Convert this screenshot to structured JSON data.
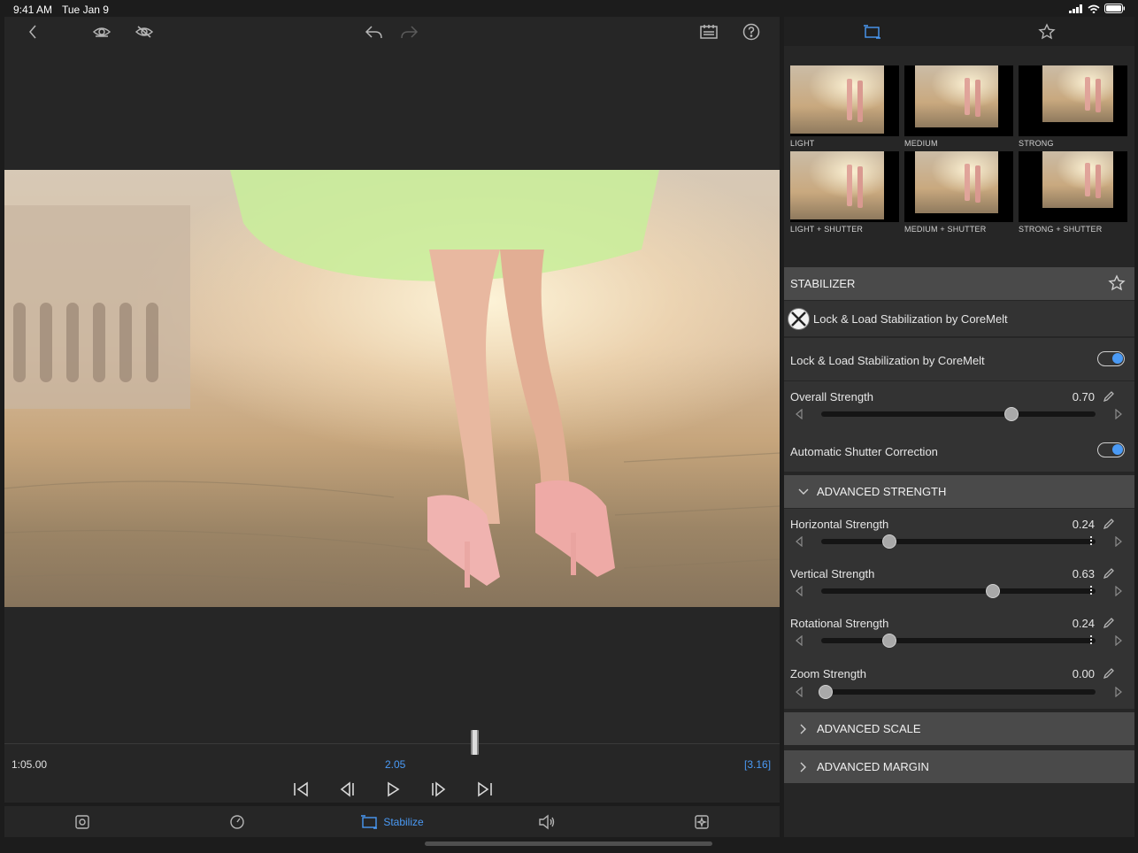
{
  "status_bar": {
    "time": "9:41 AM",
    "date": "Tue Jan 9"
  },
  "player": {
    "timecode_left": "1:05.00",
    "timecode_current": "2.05",
    "timecode_right": "[3.16]"
  },
  "bottom_tabs": {
    "stabilize_label": "Stabilize"
  },
  "presets": [
    {
      "label": "LIGHT"
    },
    {
      "label": "MEDIUM"
    },
    {
      "label": "STRONG"
    },
    {
      "label": "LIGHT + SHUTTER"
    },
    {
      "label": "MEDIUM + SHUTTER"
    },
    {
      "label": "STRONG + SHUTTER"
    }
  ],
  "stabilizer": {
    "header": "STABILIZER",
    "plugin_name": "Lock & Load Stabilization by CoreMelt",
    "enable_label": "Lock & Load Stabilization by CoreMelt",
    "enable_on": true,
    "overall_label": "Overall Strength",
    "overall_value": "0.70",
    "shutter_label": "Automatic Shutter Correction",
    "shutter_on": true
  },
  "advanced_strength": {
    "header": "ADVANCED STRENGTH",
    "sliders": [
      {
        "label": "Horizontal Strength",
        "value": "0.24"
      },
      {
        "label": "Vertical Strength",
        "value": "0.63"
      },
      {
        "label": "Rotational Strength",
        "value": "0.24"
      },
      {
        "label": "Zoom Strength",
        "value": "0.00"
      }
    ]
  },
  "advanced_scale": {
    "header": "ADVANCED SCALE"
  },
  "advanced_margin": {
    "header": "ADVANCED MARGIN"
  },
  "colors": {
    "accent": "#4a9af5",
    "panel": "#262626",
    "header": "#4a4a4a"
  },
  "icons": [
    "back-icon",
    "eye-icon",
    "eye-slash-icon",
    "undo-icon",
    "redo-icon",
    "notes-icon",
    "help-icon",
    "crop-icon",
    "star-icon",
    "coremelt-logo",
    "pencil-icon",
    "chevron-down-icon",
    "chevron-right-icon"
  ]
}
